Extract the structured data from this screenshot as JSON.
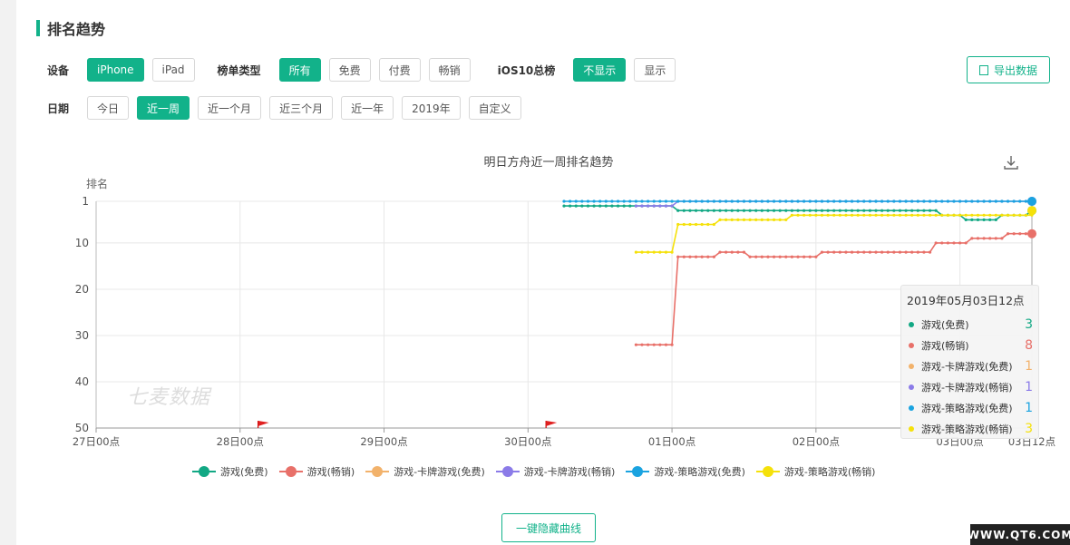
{
  "header": {
    "title": "排名趋势"
  },
  "filters": {
    "device": {
      "label": "设备",
      "options": [
        "iPhone",
        "iPad"
      ],
      "selected": "iPhone"
    },
    "list_type": {
      "label": "榜单类型",
      "options": [
        "所有",
        "免费",
        "付费",
        "畅销"
      ],
      "selected": "所有"
    },
    "ios10": {
      "label": "iOS10总榜",
      "options": [
        "不显示",
        "显示"
      ],
      "selected": "不显示"
    },
    "date": {
      "label": "日期",
      "options": [
        "今日",
        "近一周",
        "近一个月",
        "近三个月",
        "近一年",
        "2019年",
        "自定义"
      ],
      "selected": "近一周"
    },
    "export_label": "导出数据"
  },
  "colors": {
    "accent": "#12b28a"
  },
  "chart_data": {
    "type": "line",
    "title": "明日方舟近一周排名趋势",
    "ylabel": "排名",
    "y_inverted": true,
    "ylim": [
      1,
      50
    ],
    "yticks": [
      1,
      10,
      20,
      30,
      40,
      50
    ],
    "x_ticks": [
      "27日00点",
      "28日00点",
      "29日00点",
      "30日00点",
      "01日00点",
      "02日00点",
      "03日00点",
      "03日12点"
    ],
    "x_unit": "hours since 27日00点",
    "x_tick_values": [
      0,
      24,
      48,
      72,
      96,
      120,
      144,
      156
    ],
    "xlim": [
      0,
      156
    ],
    "markers": [
      {
        "x": 27
      },
      {
        "x": 75
      }
    ],
    "watermark": "七麦数据",
    "series": [
      {
        "name": "游戏(免费)",
        "color": "#12a884",
        "points": [
          [
            78,
            2
          ],
          [
            96,
            2
          ],
          [
            97,
            3
          ],
          [
            140,
            3
          ],
          [
            141,
            4
          ],
          [
            144,
            4
          ],
          [
            145,
            5
          ],
          [
            150,
            5
          ],
          [
            151,
            4
          ],
          [
            155,
            4
          ],
          [
            156,
            3
          ]
        ]
      },
      {
        "name": "游戏(畅销)",
        "color": "#e87069",
        "points": [
          [
            90,
            32
          ],
          [
            96,
            32
          ],
          [
            97,
            13
          ],
          [
            103,
            13
          ],
          [
            104,
            12
          ],
          [
            108,
            12
          ],
          [
            109,
            13
          ],
          [
            120,
            13
          ],
          [
            121,
            12
          ],
          [
            139,
            12
          ],
          [
            140,
            10
          ],
          [
            145,
            10
          ],
          [
            146,
            9
          ],
          [
            151,
            9
          ],
          [
            152,
            8
          ],
          [
            156,
            8
          ]
        ]
      },
      {
        "name": "游戏-卡牌游戏(免费)",
        "color": "#f2b26b",
        "points": []
      },
      {
        "name": "游戏-卡牌游戏(畅销)",
        "color": "#8b7be8",
        "points": [
          [
            90,
            2
          ],
          [
            96,
            2
          ],
          [
            97,
            1
          ],
          [
            140,
            1
          ],
          [
            141,
            1
          ],
          [
            156,
            1
          ]
        ]
      },
      {
        "name": "游戏-策略游戏(免费)",
        "color": "#1aa3e0",
        "points": [
          [
            78,
            1
          ],
          [
            156,
            1
          ]
        ]
      },
      {
        "name": "游戏-策略游戏(畅销)",
        "color": "#f5e10a",
        "points": [
          [
            90,
            12
          ],
          [
            96,
            12
          ],
          [
            97,
            6
          ],
          [
            103,
            6
          ],
          [
            104,
            5
          ],
          [
            115,
            5
          ],
          [
            116,
            4
          ],
          [
            156,
            4
          ],
          [
            156,
            3
          ]
        ]
      }
    ]
  },
  "tooltip": {
    "time": "2019年05月03日12点",
    "rows": [
      {
        "name": "游戏(免费)",
        "value": "3",
        "color": "#12a884"
      },
      {
        "name": "游戏(畅销)",
        "value": "8",
        "color": "#e87069"
      },
      {
        "name": "游戏-卡牌游戏(免费)",
        "value": "1",
        "color": "#f2b26b"
      },
      {
        "name": "游戏-卡牌游戏(畅销)",
        "value": "1",
        "color": "#8b7be8"
      },
      {
        "name": "游戏-策略游戏(免费)",
        "value": "1",
        "color": "#1aa3e0"
      },
      {
        "name": "游戏-策略游戏(畅销)",
        "value": "3",
        "color": "#f5e10a"
      }
    ]
  },
  "hide_curves_label": "一键隐藏曲线",
  "site_watermark": "WWW.QT6.COM"
}
